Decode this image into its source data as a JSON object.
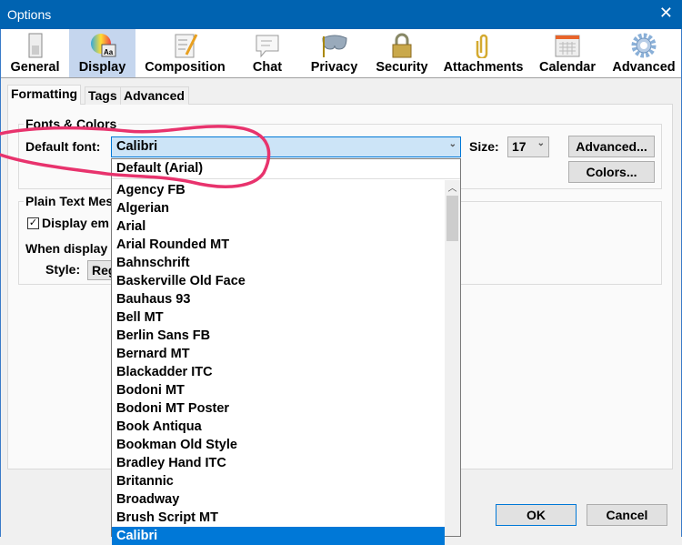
{
  "window": {
    "title": "Options",
    "close": "✕"
  },
  "toolbar": [
    {
      "label": "General",
      "icon": "switch-icon"
    },
    {
      "label": "Display",
      "icon": "color-wheel-icon",
      "selected": true
    },
    {
      "label": "Composition",
      "icon": "document-pencil-icon"
    },
    {
      "label": "Chat",
      "icon": "speech-bubble-icon"
    },
    {
      "label": "Privacy",
      "icon": "mask-icon"
    },
    {
      "label": "Security",
      "icon": "padlock-icon"
    },
    {
      "label": "Attachments",
      "icon": "paperclip-icon"
    },
    {
      "label": "Calendar",
      "icon": "calendar-icon"
    },
    {
      "label": "Advanced",
      "icon": "gear-icon"
    }
  ],
  "tabs": [
    "Formatting",
    "Tags",
    "Advanced"
  ],
  "fonts": {
    "group": "Fonts & Colors",
    "default_font_label": "Default font:",
    "default_font_value": "Calibri",
    "size_label": "Size:",
    "size_value": "17",
    "advanced_button": "Advanced...",
    "colors_button": "Colors..."
  },
  "plain": {
    "group": "Plain Text Mes",
    "display_checkbox": "Display em",
    "when_label": "When display",
    "style_label": "Style:",
    "style_value": "Reg"
  },
  "dropdown": {
    "default_item": "Default (Arial)",
    "items": [
      "Agency FB",
      "Algerian",
      "Arial",
      "Arial Rounded MT",
      "Bahnschrift",
      "Baskerville Old Face",
      "Bauhaus 93",
      "Bell MT",
      "Berlin Sans FB",
      "Bernard MT",
      "Blackadder ITC",
      "Bodoni MT",
      "Bodoni MT Poster",
      "Book Antiqua",
      "Bookman Old Style",
      "Bradley Hand ITC",
      "Britannic",
      "Broadway",
      "Brush Script MT",
      "Calibri"
    ],
    "selected": "Calibri"
  },
  "footer": {
    "ok": "OK",
    "cancel": "Cancel"
  },
  "colors": {
    "titlebar": "#0063b1",
    "selection": "#0078d7",
    "annotation": "#e8336d"
  }
}
